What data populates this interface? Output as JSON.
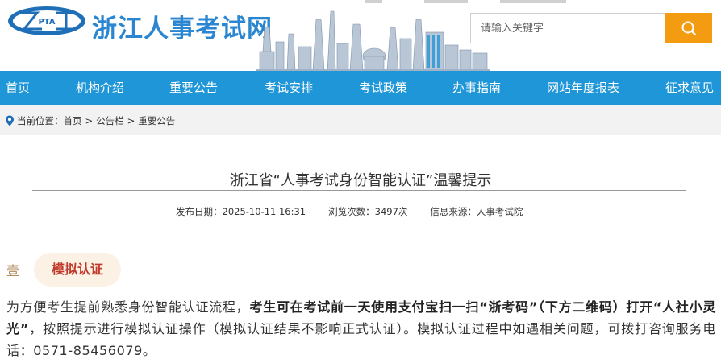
{
  "site": {
    "logo_text": "PTA",
    "title": "浙江人事考试网",
    "brand_color": "#2a86d0",
    "accent": "#f39c12"
  },
  "search": {
    "placeholder": "请输入关键字",
    "button_icon": "search-icon"
  },
  "nav": {
    "items": [
      {
        "label": "首页"
      },
      {
        "label": "机构介绍"
      },
      {
        "label": "重要公告"
      },
      {
        "label": "考试安排"
      },
      {
        "label": "考试政策"
      },
      {
        "label": "办事指南"
      },
      {
        "label": "网站年度报表"
      },
      {
        "label": "征求意见"
      }
    ]
  },
  "breadcrumb": {
    "icon": "location-pin-icon",
    "prefix": "当前位置：",
    "items": [
      "首页",
      "公告栏",
      "重要公告"
    ],
    "separator": ">"
  },
  "article": {
    "title": "浙江省“人事考试身份智能认证”温馨提示",
    "publish_date": "发布日期：2025-10-11 16:31",
    "views": "浏览次数：3497次",
    "source": "信息来源：人事考试院",
    "section": {
      "number": "壹",
      "heading": "模拟认证"
    },
    "paragraph": {
      "part1": "为方便考生提前熟悉身份智能认证流程，",
      "bold": "考生可在考试前一天使用支付宝扫一扫“浙考码”（下方二维码）打开“人社小灵光”",
      "part2": "，按照提示进行模拟认证操作（模拟认证结果不影响正式认证）。模拟认证过程中如遇相关问题，可拨打咨询服务电话：0571-85456079。"
    }
  }
}
